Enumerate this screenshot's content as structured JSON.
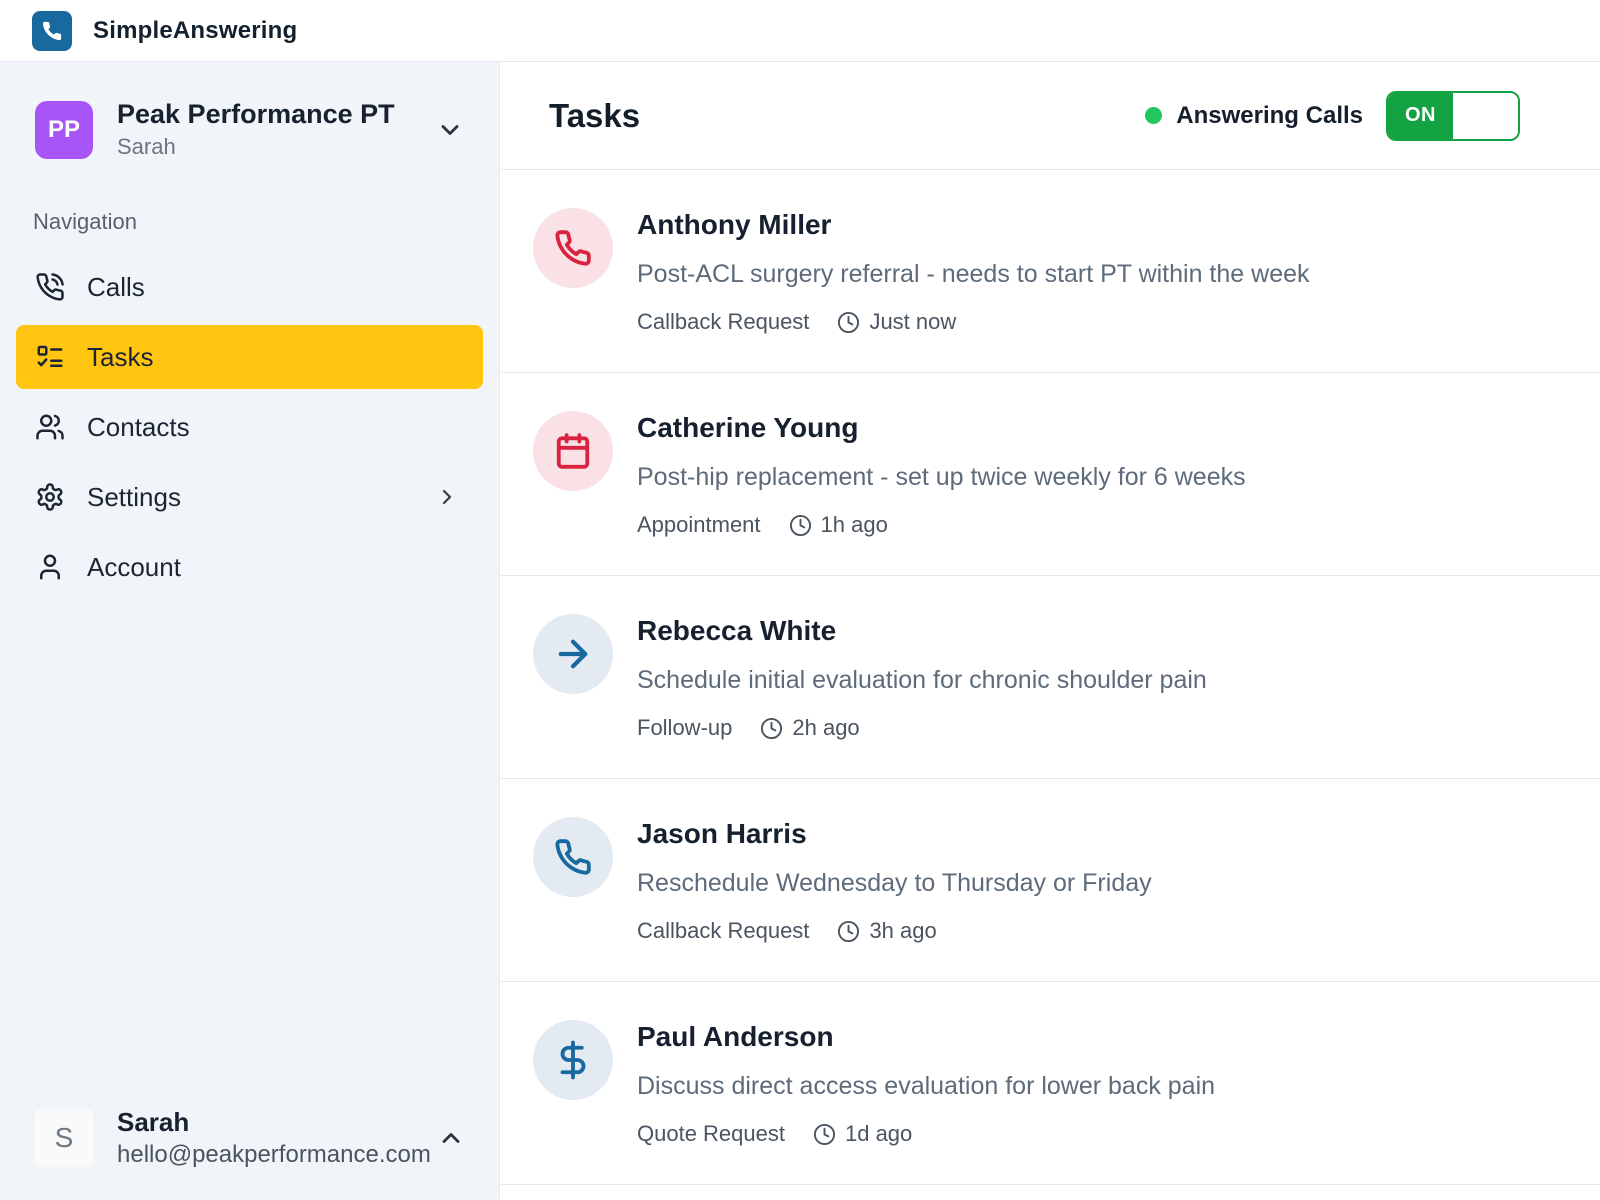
{
  "topbar": {
    "app_name": "SimpleAnswering"
  },
  "sidebar": {
    "org": {
      "initials": "PP",
      "name": "Peak Performance PT",
      "subtitle": "Sarah"
    },
    "nav_label": "Navigation",
    "items": [
      {
        "label": "Calls"
      },
      {
        "label": "Tasks"
      },
      {
        "label": "Contacts"
      },
      {
        "label": "Settings"
      },
      {
        "label": "Account"
      }
    ],
    "active_item": "Tasks",
    "user": {
      "initial": "S",
      "name": "Sarah",
      "email": "hello@peakperformance.com"
    }
  },
  "main": {
    "title": "Tasks",
    "status": {
      "label": "Answering Calls",
      "toggle_label": "ON",
      "state": "on"
    },
    "tasks": [
      {
        "name": "Anthony Miller",
        "description": "Post-ACL surgery referral - needs to start PT within the week",
        "category": "Callback Request",
        "time": "Just now",
        "icon": "phone-icon",
        "icon_color": "red"
      },
      {
        "name": "Catherine Young",
        "description": "Post-hip replacement - set up twice weekly for 6 weeks",
        "category": "Appointment",
        "time": "1h ago",
        "icon": "calendar-icon",
        "icon_color": "red"
      },
      {
        "name": "Rebecca White",
        "description": "Schedule initial evaluation for chronic shoulder pain",
        "category": "Follow-up",
        "time": "2h ago",
        "icon": "arrow-right-icon",
        "icon_color": "blue"
      },
      {
        "name": "Jason Harris",
        "description": "Reschedule Wednesday to Thursday or Friday",
        "category": "Callback Request",
        "time": "3h ago",
        "icon": "phone-icon",
        "icon_color": "blue"
      },
      {
        "name": "Paul Anderson",
        "description": "Discuss direct access evaluation for lower back pain",
        "category": "Quote Request",
        "time": "1d ago",
        "icon": "dollar-icon",
        "icon_color": "blue"
      }
    ]
  },
  "colors": {
    "brand_blue": "#18699e",
    "accent_yellow": "#ffc510",
    "toggle_green": "#14a342",
    "status_dot_green": "#22c55e",
    "task_red": "#da2340",
    "task_red_bg": "#f9e1e5",
    "task_blue": "#19689f",
    "task_blue_bg": "#e3eaf1",
    "org_purple": "#a855f7",
    "sidebar_bg": "#f1f5f9",
    "border": "#e3e8ee"
  }
}
